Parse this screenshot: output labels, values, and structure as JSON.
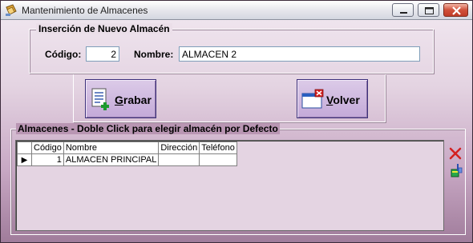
{
  "window": {
    "title": "Mantenimiento de Almacenes",
    "controls": [
      "minimize",
      "maximize",
      "close"
    ]
  },
  "insert": {
    "legend": "Inserción de Nuevo Almacén",
    "codigo_label": "Código:",
    "codigo_value": "2",
    "nombre_label": "Nombre:",
    "nombre_value": "ALMACEN 2"
  },
  "buttons": {
    "grabar_prefix": "G",
    "grabar_rest": "rabar",
    "volver_prefix": "V",
    "volver_rest": "olver"
  },
  "almacenes": {
    "legend": "Almacenes - Doble Click para elegir almacén por Defecto",
    "columns": [
      "Código",
      "Nombre",
      "Dirección",
      "Teléfono"
    ],
    "rows": [
      {
        "codigo": "1",
        "nombre": "ALMACEN PRINCIPAL",
        "direccion": "",
        "telefono": ""
      }
    ],
    "current_row_indicator": "▶"
  },
  "icons": {
    "app": "notebook-icon",
    "grabar": "document-add-icon",
    "volver": "window-close-icon",
    "delete": "red-x-icon",
    "tools": "broom-bucket-icon"
  },
  "colors": {
    "window_bg_top": "#f2e9f1",
    "window_bg_bottom": "#a07c9b",
    "button_bg": "#c3a9d8",
    "delete_red": "#d42020"
  }
}
